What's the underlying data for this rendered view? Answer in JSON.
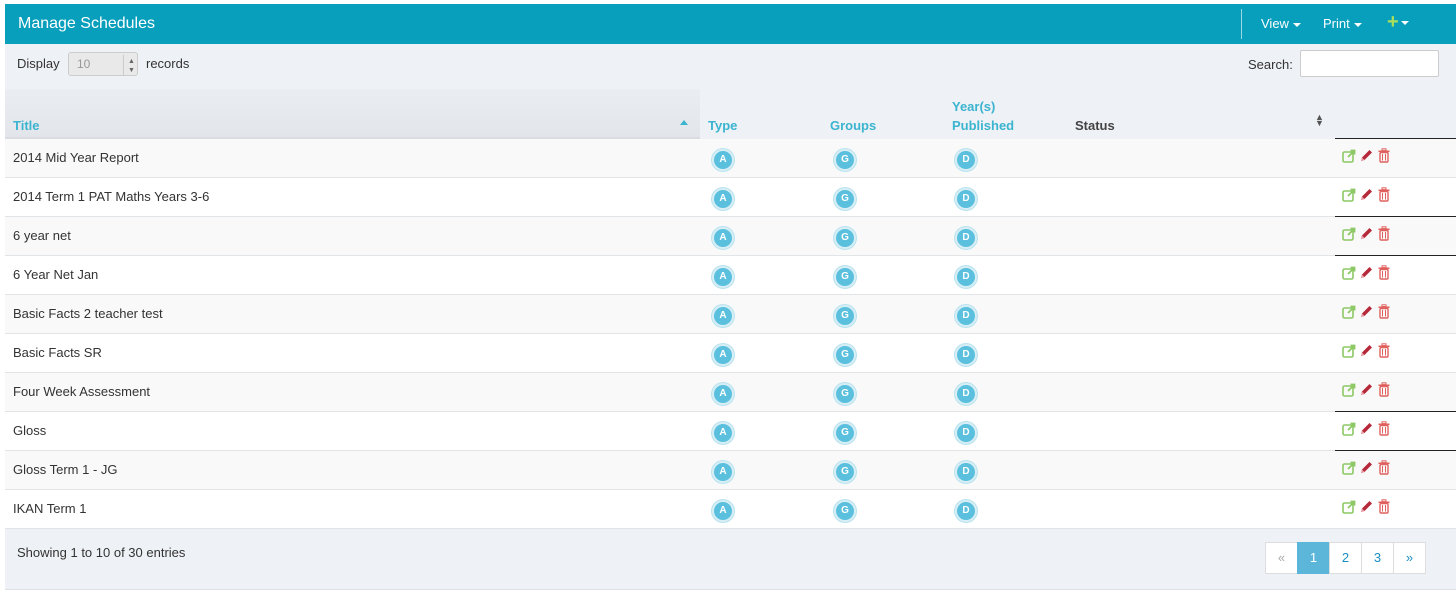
{
  "header": {
    "title": "Manage Schedules",
    "view_label": "View",
    "print_label": "Print",
    "add_label": "+"
  },
  "controls": {
    "display_label": "Display",
    "display_value": "10",
    "records_label": "records",
    "search_label": "Search:",
    "search_value": ""
  },
  "table": {
    "columns": {
      "title": "Title",
      "type": "Type",
      "groups": "Groups",
      "years_line1": "Year(s)",
      "years_line2": "Published",
      "status": "Status"
    },
    "rows": [
      {
        "title": "2014 Mid Year Report",
        "type": "A",
        "groups": "G",
        "years": "D"
      },
      {
        "title": "2014 Term 1 PAT Maths Years 3-6",
        "type": "A",
        "groups": "G",
        "years": "D"
      },
      {
        "title": "6 year net",
        "type": "A",
        "groups": "G",
        "years": "D"
      },
      {
        "title": "6 Year Net Jan",
        "type": "A",
        "groups": "G",
        "years": "D"
      },
      {
        "title": "Basic Facts 2 teacher test",
        "type": "A",
        "groups": "G",
        "years": "D"
      },
      {
        "title": "Basic Facts SR",
        "type": "A",
        "groups": "G",
        "years": "D"
      },
      {
        "title": "Four Week Assessment",
        "type": "A",
        "groups": "G",
        "years": "D"
      },
      {
        "title": "Gloss",
        "type": "A",
        "groups": "G",
        "years": "D"
      },
      {
        "title": "Gloss Term 1 - JG",
        "type": "A",
        "groups": "G",
        "years": "D"
      },
      {
        "title": "IKAN Term 1",
        "type": "A",
        "groups": "G",
        "years": "D"
      }
    ]
  },
  "footer": {
    "info": "Showing 1 to 10 of 30 entries",
    "pagination": {
      "prev": "«",
      "pages": [
        "1",
        "2",
        "3"
      ],
      "next": "»",
      "active": "1"
    }
  },
  "colors": {
    "header_bg": "#089fbd",
    "accent": "#3bb4d0",
    "badge": "#5bc0de",
    "share_icon": "#8cc864",
    "edit_icon": "#b5293b",
    "delete_icon": "#e0605e"
  }
}
